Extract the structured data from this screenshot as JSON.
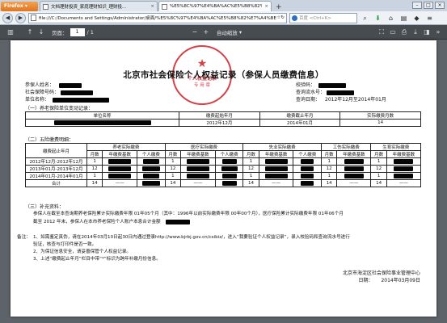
{
  "browser": {
    "app_button": "Firefox",
    "tabs": [
      {
        "label": "文档理财投资_家庭理财知识_理财投..."
      },
      {
        "label": "%E5%8C%97%E4%BA%AC%E5%B8%82%E7%A4%BE..."
      }
    ],
    "url": "file:///C:/Documents and Settings/Administrator/桌面/%E5%8C%97%E4%BA%AC%E5%B8%82%E7%A4%BE...",
    "search_placeholder": "百度 <Ctrl+K>"
  },
  "pdf_toolbar": {
    "page_label": "页面：",
    "page_value": "1",
    "page_total": "/ 1",
    "zoom_label": "自动缩放"
  },
  "document": {
    "title": "北京市社会保险个人权益记录（参保人员缴费信息）",
    "seal": {
      "line1": "个人权益记录",
      "line2": "专 用 章"
    },
    "labels": {
      "name": "参保人姓名：",
      "ssn": "社会保障号码：",
      "employer": "单位名称：",
      "check_code": "校验码：",
      "query_no": "查询流水号：",
      "query_date": "查询日期："
    },
    "query_date": "2012年12月至2014年01月",
    "section1": "（一）养老保险单位变动记录：",
    "table1": {
      "headers": [
        "单位名称",
        "缴费起始年月",
        "缴费截止年月",
        "实际缴费月数"
      ],
      "row": [
        "2012年12月",
        "2014年01月",
        "14"
      ]
    },
    "section2": "（二）五险缴费明细：",
    "table2": {
      "col_period": "缴费起止年月",
      "groups": [
        "养老实际缴费",
        "医疗实际缴费",
        "失业实际缴费",
        "工伤实际缴费",
        "生育实际缴费"
      ],
      "sub3": [
        "月数",
        "年缴费基数",
        "个人缴费"
      ],
      "sub2": [
        "月数",
        "年缴费基数"
      ],
      "rows": [
        {
          "period": "2012年12月-2012年12月",
          "months": "1"
        },
        {
          "period": "2013年01月-2013年12月",
          "months": "12"
        },
        {
          "period": "2014年01月-2014年01月",
          "months": "1"
        },
        {
          "period": "合计",
          "months": "14",
          "dash": "——"
        }
      ]
    },
    "section3": "（三）补充资料：",
    "supp1": "参保人在截至本查询期养老保险累计实际缴费年限        01年05个月（其中：1996年以前实际缴费年限 00年00个月），医疗保险累计实际缴费年限    01年06个月",
    "supp2": "截至  2012  年末，参保人在本市养老保险个人账户本息合计金额",
    "remark_title": "备注：",
    "remarks": [
      "1、如需鉴定真伪，请在2014年03月10日起30日内通过登录http://www.bjrbj.gov.cn/csibiz/，进入“我要验证个人权益记录”，录入校验码和查询流水号进行",
      "   验证，核查与打印件是否一致。",
      "2、为保证信息安全，请妥善保管个人权益记录。",
      "3、上述“缴费起止年月”栏目中带“*”标识为跨年补缴月份信息。"
    ],
    "issuer": "北京市海淀区社会保险事业管理中心",
    "date_label": "日期：",
    "date": "2014年03月09日"
  }
}
